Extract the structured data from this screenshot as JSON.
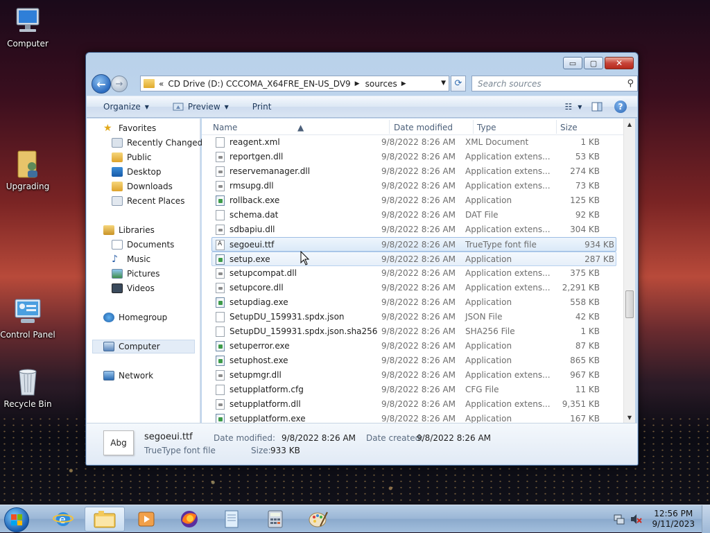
{
  "desktop": {
    "icons": [
      {
        "label": "Computer"
      },
      {
        "label": "Upgrading"
      },
      {
        "label": "Control Panel"
      },
      {
        "label": "Recycle Bin"
      }
    ]
  },
  "window": {
    "controls": {
      "minimize": "▭",
      "maximize": "▢",
      "close": "✕"
    },
    "address": {
      "back": "←",
      "forward": "→",
      "overflow": "«",
      "crumbs": [
        "CD Drive (D:) CCCOMA_X64FRE_EN-US_DV9",
        "sources"
      ],
      "separator": "▶",
      "dropdown": "▼",
      "refresh": "⟳"
    },
    "search": {
      "placeholder": "Search sources",
      "icon": "⚲"
    },
    "toolbar": {
      "organize": "Organize",
      "preview": "Preview",
      "print": "Print",
      "caret": "▼",
      "views_icon": "☷",
      "help": "?"
    },
    "nav": {
      "favorites": "Favorites",
      "recently_changed": "Recently Changed",
      "public": "Public",
      "desktop": "Desktop",
      "downloads": "Downloads",
      "recent_places": "Recent Places",
      "libraries": "Libraries",
      "documents": "Documents",
      "music": "Music",
      "pictures": "Pictures",
      "videos": "Videos",
      "homegroup": "Homegroup",
      "computer": "Computer",
      "network": "Network"
    },
    "columns": {
      "name": "Name",
      "date": "Date modified",
      "type": "Type",
      "size": "Size"
    },
    "files": [
      {
        "name": "reagent.xml",
        "date": "9/8/2022 8:26 AM",
        "type": "XML Document",
        "size": "1 KB"
      },
      {
        "name": "reportgen.dll",
        "date": "9/8/2022 8:26 AM",
        "type": "Application extens...",
        "size": "53 KB"
      },
      {
        "name": "reservemanager.dll",
        "date": "9/8/2022 8:26 AM",
        "type": "Application extens...",
        "size": "274 KB"
      },
      {
        "name": "rmsupg.dll",
        "date": "9/8/2022 8:26 AM",
        "type": "Application extens...",
        "size": "73 KB"
      },
      {
        "name": "rollback.exe",
        "date": "9/8/2022 8:26 AM",
        "type": "Application",
        "size": "125 KB"
      },
      {
        "name": "schema.dat",
        "date": "9/8/2022 8:26 AM",
        "type": "DAT File",
        "size": "92 KB"
      },
      {
        "name": "sdbapiu.dll",
        "date": "9/8/2022 8:26 AM",
        "type": "Application extens...",
        "size": "304 KB"
      },
      {
        "name": "segoeui.ttf",
        "date": "9/8/2022 8:26 AM",
        "type": "TrueType font file",
        "size": "934 KB"
      },
      {
        "name": "setup.exe",
        "date": "9/8/2022 8:26 AM",
        "type": "Application",
        "size": "287 KB"
      },
      {
        "name": "setupcompat.dll",
        "date": "9/8/2022 8:26 AM",
        "type": "Application extens...",
        "size": "375 KB"
      },
      {
        "name": "setupcore.dll",
        "date": "9/8/2022 8:26 AM",
        "type": "Application extens...",
        "size": "2,291 KB"
      },
      {
        "name": "setupdiag.exe",
        "date": "9/8/2022 8:26 AM",
        "type": "Application",
        "size": "558 KB"
      },
      {
        "name": "SetupDU_159931.spdx.json",
        "date": "9/8/2022 8:26 AM",
        "type": "JSON File",
        "size": "42 KB"
      },
      {
        "name": "SetupDU_159931.spdx.json.sha256",
        "date": "9/8/2022 8:26 AM",
        "type": "SHA256 File",
        "size": "1 KB"
      },
      {
        "name": "setuperror.exe",
        "date": "9/8/2022 8:26 AM",
        "type": "Application",
        "size": "87 KB"
      },
      {
        "name": "setuphost.exe",
        "date": "9/8/2022 8:26 AM",
        "type": "Application",
        "size": "865 KB"
      },
      {
        "name": "setupmgr.dll",
        "date": "9/8/2022 8:26 AM",
        "type": "Application extens...",
        "size": "967 KB"
      },
      {
        "name": "setupplatform.cfg",
        "date": "9/8/2022 8:26 AM",
        "type": "CFG File",
        "size": "11 KB"
      },
      {
        "name": "setupplatform.dll",
        "date": "9/8/2022 8:26 AM",
        "type": "Application extens...",
        "size": "9,351 KB"
      },
      {
        "name": "setupplatform.exe",
        "date": "9/8/2022 8:26 AM",
        "type": "Application",
        "size": "167 KB"
      }
    ],
    "details": {
      "thumb": "Abg",
      "name": "segoeui.ttf",
      "type": "TrueType font file",
      "modified_label": "Date modified:",
      "modified": "9/8/2022 8:26 AM",
      "created_label": "Date created:",
      "created": "9/8/2022 8:26 AM",
      "size_label": "Size:",
      "size": "933 KB"
    },
    "scroll": {
      "up": "▲",
      "down": "▼"
    }
  },
  "taskbar": {
    "time": "12:56 PM",
    "date": "9/11/2023"
  }
}
